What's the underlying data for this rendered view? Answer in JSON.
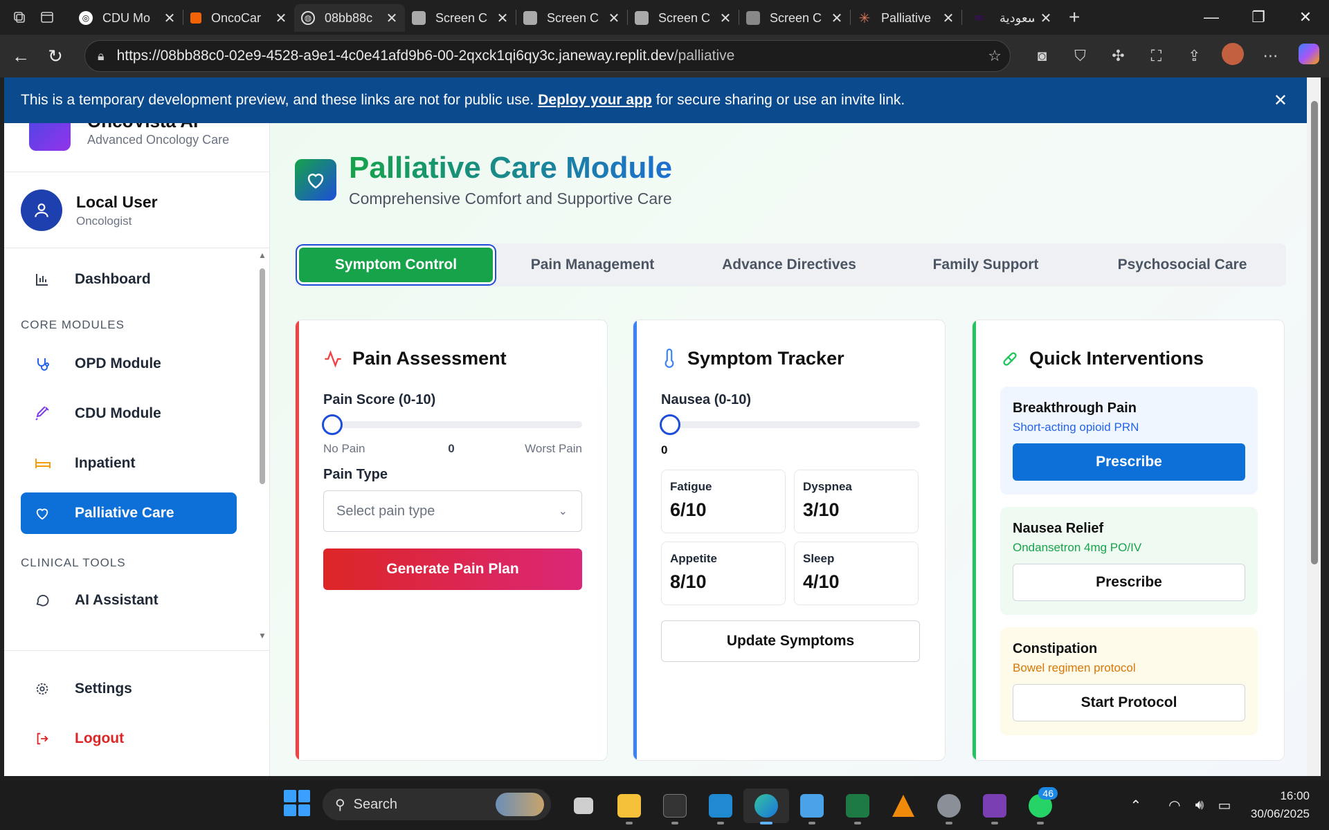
{
  "browser": {
    "tabs": [
      {
        "title": "CDU Mo",
        "favicon": "openai-icon",
        "active": false
      },
      {
        "title": "OncoCar",
        "favicon": "replit-icon",
        "active": false
      },
      {
        "title": "08bb88c",
        "favicon": "globe-icon",
        "active": true
      },
      {
        "title": "Screen C",
        "favicon": "camera-icon",
        "active": false
      },
      {
        "title": "Screen C",
        "favicon": "camera-icon",
        "active": false
      },
      {
        "title": "Screen C",
        "favicon": "camera-icon",
        "active": false
      },
      {
        "title": "Screen C",
        "favicon": "camera-icon",
        "active": false
      },
      {
        "title": "Palliative",
        "favicon": "claude-icon",
        "active": false
      },
      {
        "title": "السعودية",
        "favicon": "stc-icon",
        "active": false
      }
    ],
    "url_main": "https://08bb88c0-02e9-4528-a9e1-4c0e41afd9b6-00-2qxck1qi6qy3c.janeway.replit.dev",
    "url_path": "/palliative"
  },
  "banner": {
    "text_before": "This is a temporary development preview, and these links are not for public use.",
    "link": "Deploy your app",
    "text_after": "for secure sharing or use an invite link."
  },
  "sidebar": {
    "brand_name": "OncoVista AI",
    "brand_sub": "Advanced Oncology Care",
    "user_name": "Local User",
    "user_role": "Oncologist",
    "items": [
      {
        "label": "Dashboard",
        "icon": "bar-chart-icon"
      },
      {
        "label": "OPD Module",
        "icon": "stethoscope-icon"
      },
      {
        "label": "CDU Module",
        "icon": "syringe-icon"
      },
      {
        "label": "Inpatient",
        "icon": "bed-icon"
      },
      {
        "label": "Palliative Care",
        "icon": "heart-icon",
        "active": true
      },
      {
        "label": "AI Assistant",
        "icon": "chat-bubble-icon"
      }
    ],
    "section_core": "CORE MODULES",
    "section_clinical": "CLINICAL TOOLS",
    "settings": "Settings",
    "logout": "Logout"
  },
  "page": {
    "title": "Palliative Care Module",
    "subtitle": "Comprehensive Comfort and Supportive Care",
    "tabs": [
      "Symptom Control",
      "Pain Management",
      "Advance Directives",
      "Family Support",
      "Psychosocial Care"
    ],
    "active_tab": "Symptom Control"
  },
  "pain": {
    "title": "Pain Assessment",
    "score_label": "Pain Score (0-10)",
    "score": "0",
    "min_label": "No Pain",
    "max_label": "Worst Pain",
    "type_label": "Pain Type",
    "type_placeholder": "Select pain type",
    "button": "Generate Pain Plan",
    "accent": "#ef4444"
  },
  "symptoms": {
    "title": "Symptom Tracker",
    "nausea_label": "Nausea (0-10)",
    "nausea": "0",
    "stats": [
      {
        "label": "Fatigue",
        "value": "6/10"
      },
      {
        "label": "Dyspnea",
        "value": "3/10"
      },
      {
        "label": "Appetite",
        "value": "8/10"
      },
      {
        "label": "Sleep",
        "value": "4/10"
      }
    ],
    "button": "Update Symptoms",
    "accent": "#3b82f6"
  },
  "interventions": {
    "title": "Quick Interventions",
    "accent": "#22c55e",
    "items": [
      {
        "title": "Breakthrough Pain",
        "sub": "Short-acting opioid PRN",
        "button": "Prescribe"
      },
      {
        "title": "Nausea Relief",
        "sub": "Ondansetron 4mg PO/IV",
        "button": "Prescribe"
      },
      {
        "title": "Constipation",
        "sub": "Bowel regimen protocol",
        "button": "Start Protocol"
      }
    ]
  },
  "taskbar": {
    "search": "Search",
    "whatsapp_badge": "46",
    "time": "16:00",
    "date": "30/06/2025"
  }
}
